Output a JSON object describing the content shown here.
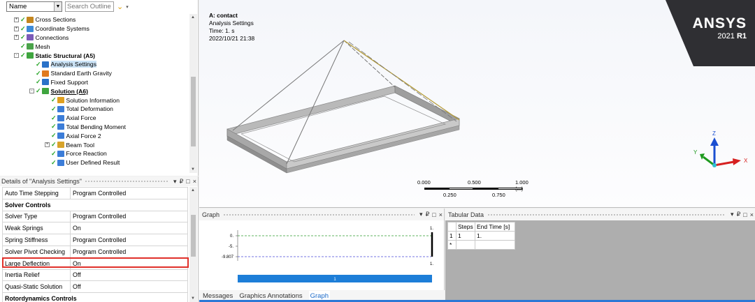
{
  "outline": {
    "sort_combo": "Name",
    "search_placeholder": "Search Outline",
    "tree": [
      {
        "label": "Cross Sections",
        "level": 1,
        "expander": "+",
        "icon_color": "#c4861e",
        "style": ""
      },
      {
        "label": "Coordinate Systems",
        "level": 1,
        "expander": "+",
        "icon_color": "#3c8bd8",
        "style": ""
      },
      {
        "label": "Connections",
        "level": 1,
        "expander": "+",
        "icon_color": "#7b5bb8",
        "style": ""
      },
      {
        "label": "Mesh",
        "level": 1,
        "expander": "",
        "icon_color": "#4aa34a",
        "style": ""
      },
      {
        "label": "Static Structural (A5)",
        "level": 1,
        "expander": "-",
        "icon_color": "#3fa53f",
        "style": "bold"
      },
      {
        "label": "Analysis Settings",
        "level": 2,
        "expander": "",
        "icon_color": "#2a71c8",
        "style": "selected"
      },
      {
        "label": "Standard Earth Gravity",
        "level": 2,
        "expander": "",
        "icon_color": "#e07a1f",
        "style": ""
      },
      {
        "label": "Fixed Support",
        "level": 2,
        "expander": "",
        "icon_color": "#2a71c8",
        "style": ""
      },
      {
        "label": "Solution (A6)",
        "level": 2,
        "expander": "-",
        "icon_color": "#3fa53f",
        "style": "underline"
      },
      {
        "label": "Solution Information",
        "level": 3,
        "expander": "",
        "icon_color": "#e0a020",
        "style": ""
      },
      {
        "label": "Total Deformation",
        "level": 3,
        "expander": "",
        "icon_color": "#3c7dd8",
        "style": ""
      },
      {
        "label": "Axial Force",
        "level": 3,
        "expander": "",
        "icon_color": "#3c7dd8",
        "style": ""
      },
      {
        "label": "Total Bending Moment",
        "level": 3,
        "expander": "",
        "icon_color": "#3c7dd8",
        "style": ""
      },
      {
        "label": "Axial Force 2",
        "level": 3,
        "expander": "",
        "icon_color": "#3c7dd8",
        "style": ""
      },
      {
        "label": "Beam Tool",
        "level": 3,
        "expander": "+",
        "icon_color": "#d7a32a",
        "style": ""
      },
      {
        "label": "Force Reaction",
        "level": 3,
        "expander": "",
        "icon_color": "#3c7dd8",
        "style": ""
      },
      {
        "label": "User Defined Result",
        "level": 3,
        "expander": "",
        "icon_color": "#3c7dd8",
        "style": ""
      }
    ]
  },
  "details": {
    "title": "Details of \"Analysis Settings\"",
    "pin_label": "₽",
    "rows": [
      {
        "key": "Auto Time Stepping",
        "value": "Program Controlled",
        "category": false
      },
      {
        "key": "Solver Controls",
        "value": "",
        "category": true
      },
      {
        "key": "Solver Type",
        "value": "Program Controlled",
        "category": false
      },
      {
        "key": "Weak Springs",
        "value": "On",
        "category": false
      },
      {
        "key": "Spring Stiffness",
        "value": "Program Controlled",
        "category": false
      },
      {
        "key": "Solver Pivot Checking",
        "value": "Program Controlled",
        "category": false
      },
      {
        "key": "Large Deflection",
        "value": "On",
        "category": false
      },
      {
        "key": "Inertia Relief",
        "value": "Off",
        "category": false
      },
      {
        "key": "Quasi-Static Solution",
        "value": "Off",
        "category": false
      },
      {
        "key": "Rotordynamics Controls",
        "value": "",
        "category": true
      }
    ]
  },
  "viewport": {
    "title": "A: contact",
    "subtitle": "Analysis Settings",
    "time": "Time: 1. s",
    "date": "2022/10/21 21:38",
    "brand": "ANSYS",
    "version": "2021",
    "release": "R1",
    "scale_labels": {
      "t0": "0.000",
      "t1": "0.500",
      "t2": "1.000 (m)",
      "b1": "0.250",
      "b2": "0.750"
    },
    "triad": {
      "x": "X",
      "y": "Y",
      "z": "Z"
    }
  },
  "graph": {
    "title": "Graph",
    "y_labels": [
      "0.",
      "-5.",
      "-9.807"
    ],
    "right_labels": [
      "1.",
      "1."
    ],
    "bar_label": "1",
    "tabs": [
      {
        "label": "Messages",
        "active": false
      },
      {
        "label": "Graphics Annotations",
        "active": false
      },
      {
        "label": "Graph",
        "active": true
      }
    ]
  },
  "tabular": {
    "title": "Tabular Data",
    "headers": [
      "",
      "Steps",
      "End Time [s]"
    ],
    "rows": [
      [
        "1",
        "1",
        "1."
      ],
      [
        "*",
        "",
        ""
      ]
    ]
  },
  "pane_controls": {
    "pin": "₽",
    "max": "□",
    "close": "×",
    "menu": "▾"
  }
}
